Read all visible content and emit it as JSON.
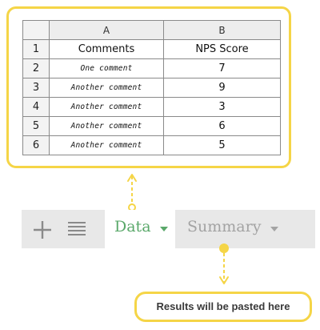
{
  "sheet": {
    "column_headers": [
      "A",
      "B"
    ],
    "rows": [
      {
        "num": "1",
        "a": "Comments",
        "b": "NPS Score"
      },
      {
        "num": "2",
        "a": "One comment",
        "b": "7"
      },
      {
        "num": "3",
        "a": "Another comment",
        "b": "9"
      },
      {
        "num": "4",
        "a": "Another comment",
        "b": "3"
      },
      {
        "num": "5",
        "a": "Another comment",
        "b": "6"
      },
      {
        "num": "6",
        "a": "Another comment",
        "b": "5"
      }
    ]
  },
  "tabs": {
    "data_label": "Data",
    "summary_label": "Summary"
  },
  "note": {
    "text": "Results will be pasted here"
  },
  "colors": {
    "highlight": "#f5d547",
    "active_tab": "#5aa86a",
    "inactive_tab": "#a3a3a3"
  }
}
